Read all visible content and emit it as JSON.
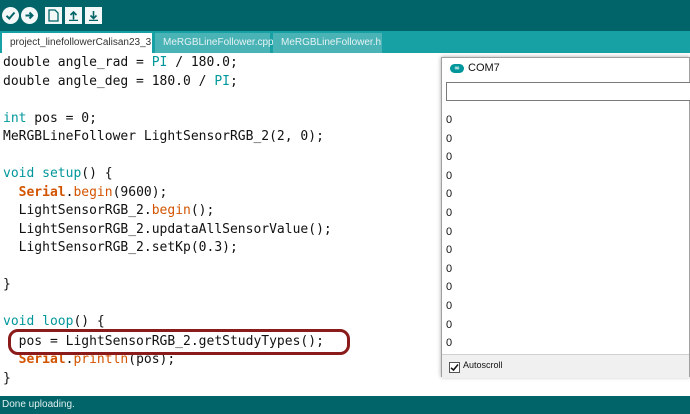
{
  "toolbar": {
    "buttons": [
      {
        "name": "verify",
        "icon": "checkmark-icon"
      },
      {
        "name": "upload",
        "icon": "arrow-right-icon"
      },
      {
        "name": "new",
        "icon": "new-file-icon"
      },
      {
        "name": "open",
        "icon": "arrow-up-icon"
      },
      {
        "name": "save",
        "icon": "arrow-down-icon"
      }
    ]
  },
  "tabs": [
    {
      "label": "project_linefollowerCalisan23_3",
      "active": true
    },
    {
      "label": "MeRGBLineFollower.cpp",
      "active": false
    },
    {
      "label": "MeRGBLineFollower.h",
      "active": false
    }
  ],
  "code": {
    "l1": {
      "a": "double angle_rad = ",
      "b": "PI",
      "c": " / 180.0;"
    },
    "l2": {
      "a": "double angle_deg = 180.0 / ",
      "b": "PI",
      "c": ";"
    },
    "l4": {
      "a": "int",
      "b": " pos = 0;"
    },
    "l5": "MeRGBLineFollower LightSensorRGB_2(2, 0);",
    "l7": {
      "a": "void",
      "b": " ",
      "c": "setup",
      "d": "() {"
    },
    "l8": {
      "a": "  ",
      "b": "Serial",
      "c": ".",
      "d": "begin",
      "e": "(9600);"
    },
    "l9": {
      "a": "  LightSensorRGB_2.",
      "b": "begin",
      "c": "();"
    },
    "l10": "  LightSensorRGB_2.updataAllSensorValue();",
    "l11": "  LightSensorRGB_2.setKp(0.3);",
    "l13": "}",
    "l15": {
      "a": "void",
      "b": " ",
      "c": "loop",
      "d": "() {"
    },
    "l16": "  pos = LightSensorRGB_2.getStudyTypes();",
    "l17": {
      "a": "  ",
      "b": "Serial",
      "c": ".",
      "d": "println",
      "e": "(pos);"
    },
    "l18": "}"
  },
  "monitor": {
    "title": "COM7",
    "logo": "∞",
    "input_value": "",
    "output_lines": [
      "0",
      "0",
      "0",
      "0",
      "0",
      "0",
      "0",
      "0",
      "0",
      "0",
      "0",
      "0",
      "0"
    ],
    "autoscroll_label": "Autoscroll",
    "autoscroll_checked": true
  },
  "status": {
    "text": "Done uploading."
  },
  "colors": {
    "toolbar": "#006468",
    "tabs_bar": "#17a1a5",
    "keyword": "#00979c",
    "function": "#d35400",
    "highlight_box": "#8b1a1a"
  }
}
